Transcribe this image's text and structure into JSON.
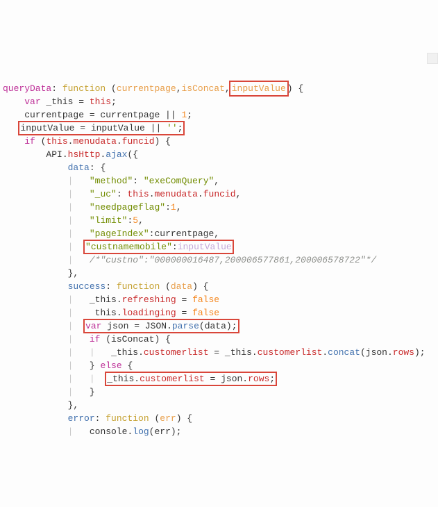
{
  "code": {
    "l1_fn": "queryData",
    "l1_colon": ": ",
    "l1_kw_function": "function",
    "l1_open": " (",
    "l1_p1": "currentpage",
    "l1_c1": ",",
    "l1_p2": "isConcat",
    "l1_c2": ",",
    "l1_p3": "inputValue",
    "l1_close": ") {",
    "l2_var": "var",
    "l2_rest": " _this = ",
    "l2_this": "this",
    "l2_semi": ";",
    "l3_a": "currentpage = currentpage || ",
    "l3_num": "1",
    "l3_semi": ";",
    "l4_a": "inputValue = inputValue || ",
    "l4_str": "''",
    "l4_semi": ";",
    "l5_if": "if",
    "l5_open": " (",
    "l5_this": "this",
    "l5_dot": ".",
    "l5_menudata": "menudata",
    "l5_dot2": ".",
    "l5_funcid": "funcid",
    "l5_close": ") {",
    "l6_api": "API.",
    "l6_hs": "hsHttp",
    "l6_dot": ".",
    "l6_ajax": "ajax",
    "l6_open": "({",
    "l7_data": "data",
    "l7_colon": ": {",
    "l8_k": "\"method\"",
    "l8_c": ": ",
    "l8_v": "\"exeComQuery\"",
    "l8_comma": ",",
    "l9_k": "\"_uc\"",
    "l9_c": ": ",
    "l9_this": "this",
    "l9_dot": ".",
    "l9_menudata": "menudata",
    "l9_dot2": ".",
    "l9_funcid": "funcid",
    "l9_comma": ",",
    "l10_k": "\"needpageflag\"",
    "l10_c": ":",
    "l10_v": "1",
    "l10_comma": ",",
    "l11_k": "\"limit\"",
    "l11_c": ":",
    "l11_v": "5",
    "l11_comma": ",",
    "l12_k": "\"pageIndex\"",
    "l12_c": ":currentpage,",
    "l13_k": "\"custnamemobile\"",
    "l13_c": ":",
    "l13_v": "inputValue",
    "l14_comment": "/*\"custno\":\"000000016487,200006577861,200006578722\"*/",
    "l15_close": "},",
    "l16_succ": "success",
    "l16_c": ": ",
    "l16_fn": "function",
    "l16_open": " (",
    "l16_p": "data",
    "l16_close": ") {",
    "l17_a": "_this.",
    "l17_prop": "refreshing",
    "l17_eq": " = ",
    "l17_val": "false",
    "l18_a": " this.",
    "l18_prop": "loadinging",
    "l18_eq": " = ",
    "l18_val": "false",
    "l19_var": "var",
    "l19_a": " json = JSON.",
    "l19_parse": "parse",
    "l19_open": "(data);",
    "l20_if": "if",
    "l20_rest": " (isConcat) {",
    "l21_a": "_this.",
    "l21_prop": "customerlist",
    "l21_eq": " = _this.",
    "l21_prop2": "customerlist",
    "l21_dot": ".",
    "l21_concat": "concat",
    "l21_rest": "(json.",
    "l21_rows": "rows",
    "l21_close": ");",
    "l22_close": "} ",
    "l22_else": "else",
    "l22_open": " {",
    "l23_a": "_this.",
    "l23_prop": "customerlist",
    "l23_eq": " = json.",
    "l23_rows": "rows",
    "l23_semi": ";",
    "l24_close": "}",
    "l25_close": "},",
    "l26_err": "error",
    "l26_c": ": ",
    "l26_fn": "function",
    "l26_open": " (",
    "l26_p": "err",
    "l26_close": ") {",
    "l27_a": "console.",
    "l27_log": "log",
    "l27_rest": "(err);"
  }
}
